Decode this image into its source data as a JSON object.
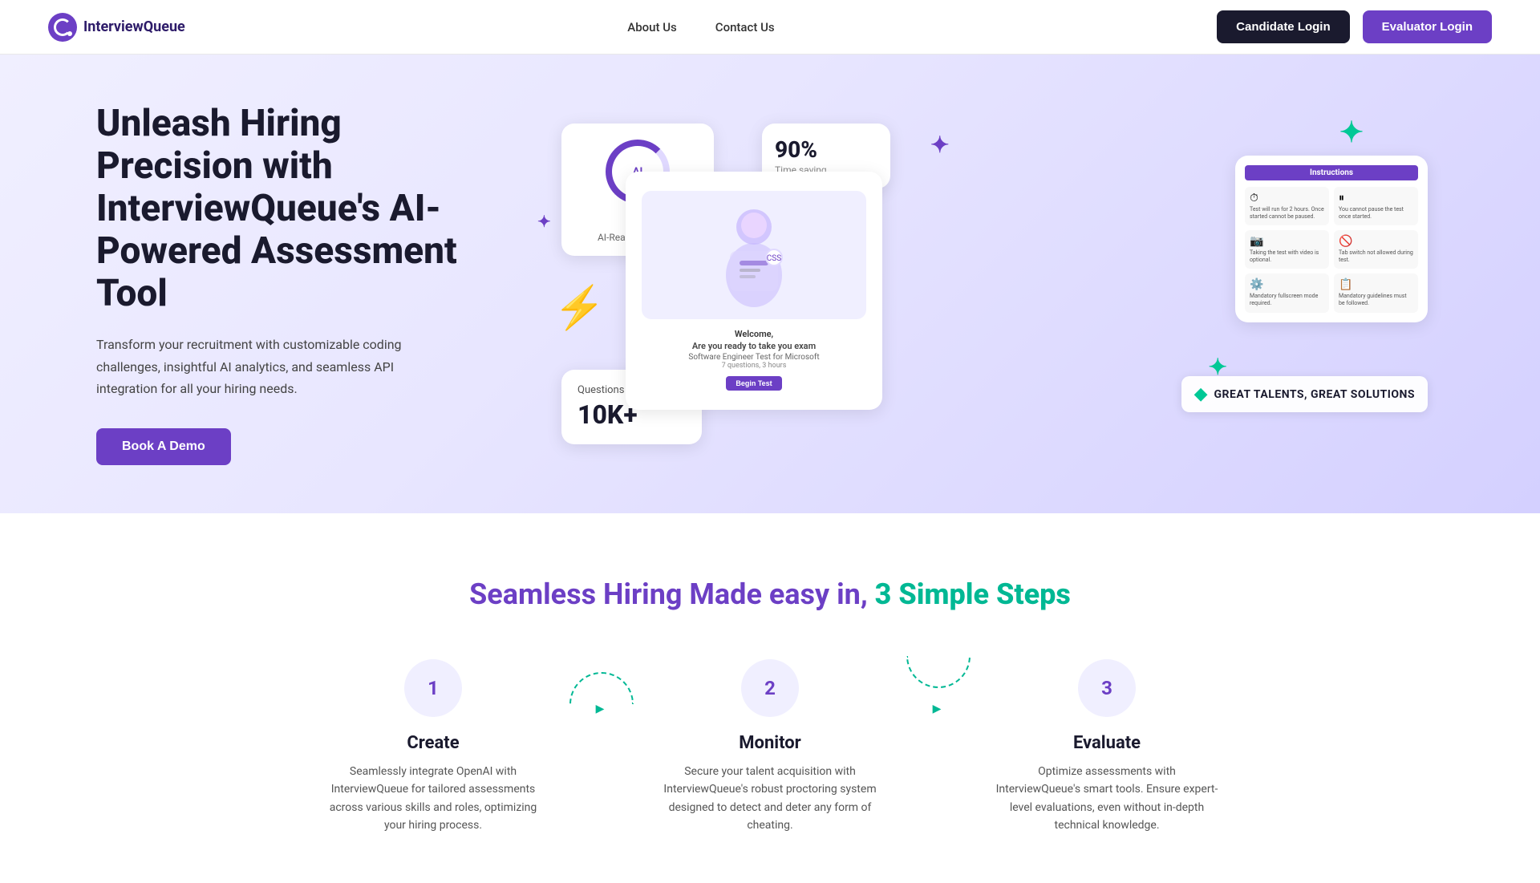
{
  "nav": {
    "logo_text": "InterviewQueue",
    "links": [
      {
        "label": "About Us",
        "href": "#"
      },
      {
        "label": "Contact Us",
        "href": "#"
      }
    ],
    "btn_candidate": "Candidate Login",
    "btn_evaluator": "Evaluator Login"
  },
  "hero": {
    "title": "Unleash Hiring Precision with InterviewQueue's AI-Powered Assessment Tool",
    "subtitle": "Transform your recruitment with customizable coding challenges, insightful AI analytics, and seamless API integration for all your hiring needs.",
    "cta": "Book A Demo",
    "card_ai_label": "AI",
    "card_ai_sub": "AI-Ready Solutions",
    "card_saving_pct": "90%",
    "card_saving_label": "Time saving",
    "card_welcome": "Welcome,",
    "card_ready": "Are you ready to take you exam",
    "card_test_name": "Software Engineer Test for Microsoft",
    "card_test_info": "7 questions, 3 hours",
    "card_instr_title": "Instructions",
    "card_q_label": "Questions",
    "card_q_count": "10K+",
    "banner_text": "GREAT TALENTS, GREAT SOLUTIONS"
  },
  "section2": {
    "title_part1": "Seamless Hiring Made easy in,",
    "title_part2": "3 Simple Steps",
    "steps": [
      {
        "num": "1",
        "title": "Create",
        "desc": "Seamlessly integrate OpenAI with InterviewQueue for tailored assessments across various skills and roles, optimizing your hiring process."
      },
      {
        "num": "2",
        "title": "Monitor",
        "desc": "Secure your talent acquisition with InterviewQueue's robust proctoring system designed to detect and deter any form of cheating."
      },
      {
        "num": "3",
        "title": "Evaluate",
        "desc": "Optimize assessments with InterviewQueue's smart tools. Ensure expert-level evaluations, even without in-depth technical knowledge."
      }
    ]
  }
}
